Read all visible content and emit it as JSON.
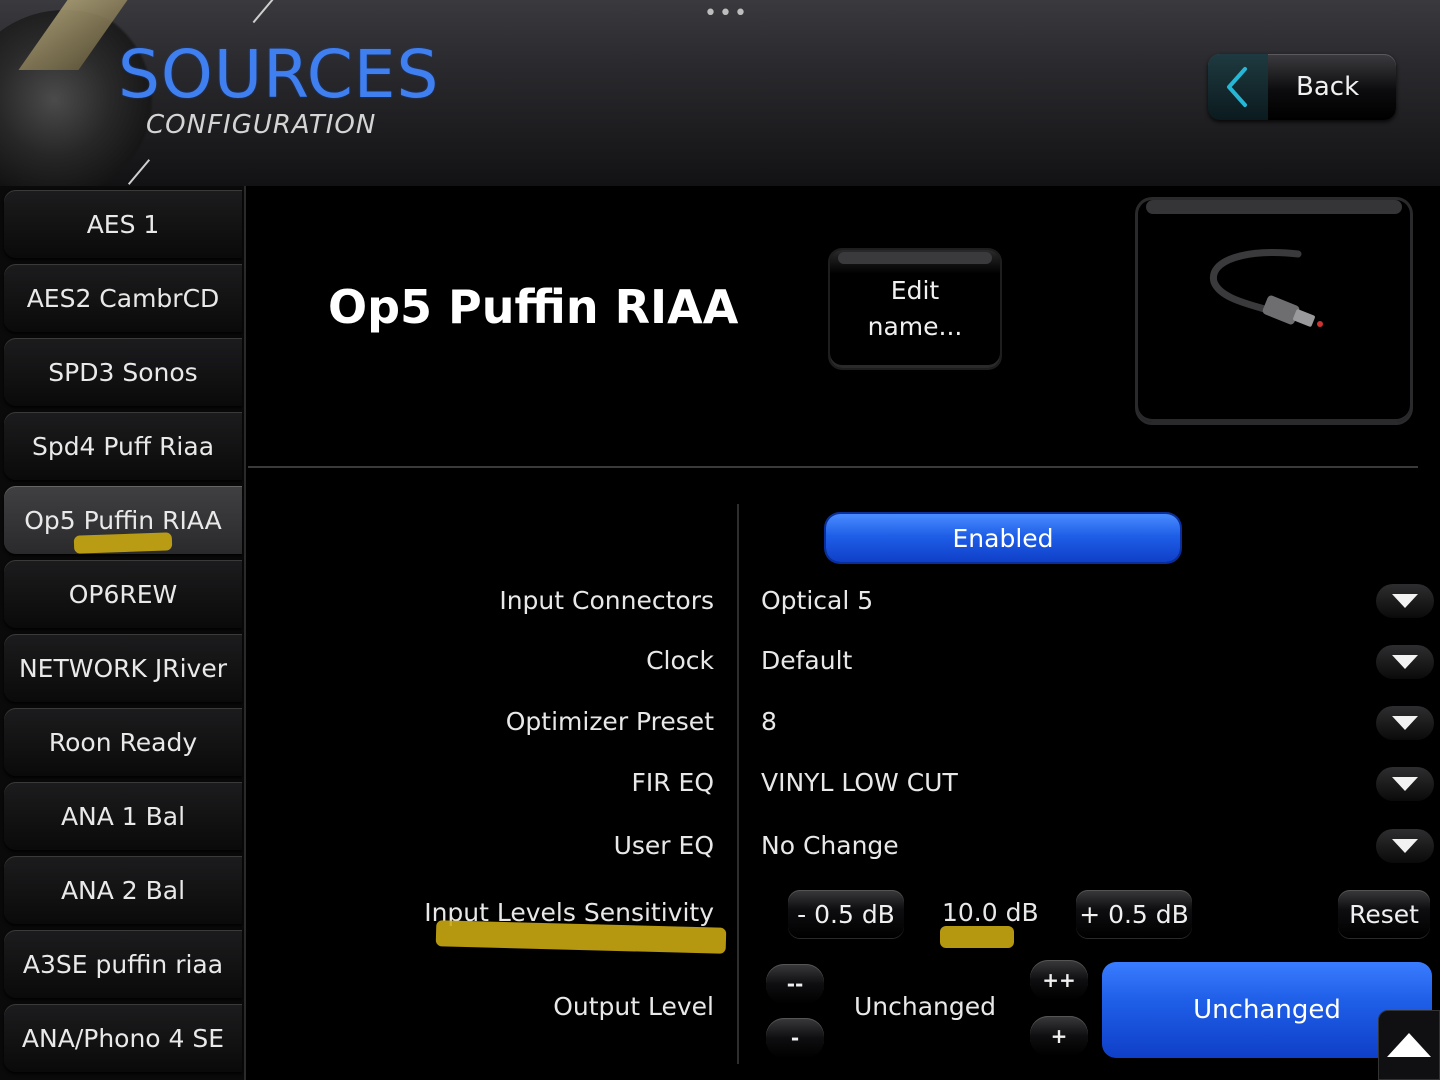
{
  "header": {
    "title": "SOURCES",
    "subtitle": "CONFIGURATION",
    "back_label": "Back",
    "more_dots": "•••"
  },
  "sidebar": {
    "items": [
      {
        "label": "AES 1"
      },
      {
        "label": "AES2 CambrCD"
      },
      {
        "label": "SPD3 Sonos"
      },
      {
        "label": "Spd4 Puff Riaa"
      },
      {
        "label": "Op5 Puffin RIAA",
        "active": true
      },
      {
        "label": "OP6REW"
      },
      {
        "label": "NETWORK JRiver"
      },
      {
        "label": "Roon Ready"
      },
      {
        "label": "ANA 1 Bal"
      },
      {
        "label": "ANA 2 Bal"
      },
      {
        "label": "A3SE puffin riaa"
      },
      {
        "label": "ANA/Phono 4 SE"
      }
    ]
  },
  "main": {
    "source_name": "Op5 Puffin RIAA",
    "edit_button_line1": "Edit",
    "edit_button_line2": "name...",
    "enabled_label": "Enabled",
    "rows": [
      {
        "label": "Input Connectors",
        "value": "Optical 5"
      },
      {
        "label": "Clock",
        "value": "Default"
      },
      {
        "label": "Optimizer Preset",
        "value": "8"
      },
      {
        "label": "FIR EQ",
        "value": "VINYL LOW CUT"
      },
      {
        "label": "User EQ",
        "value": "No Change"
      }
    ],
    "input_levels": {
      "label": "Input Levels Sensitivity",
      "minus_label": "- 0.5 dB",
      "value": "10.0 dB",
      "plus_label": "+ 0.5 dB",
      "reset_label": "Reset"
    },
    "output_level": {
      "label": "Output Level",
      "double_minus": "--",
      "minus": "-",
      "value": "Unchanged",
      "double_plus": "++",
      "plus": "+",
      "button_label": "Unchanged"
    }
  },
  "colors": {
    "accent_blue": "#1f5fe8",
    "logo_blue": "#3f7ff0",
    "highlight_yellow": "#c9a812"
  }
}
